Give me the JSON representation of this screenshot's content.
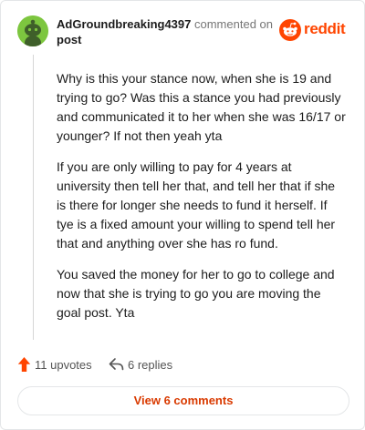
{
  "header": {
    "username": "AdGroundbreaking4397",
    "action_text": "commented on",
    "post_link": "post",
    "logo_text": "reddit",
    "avatar_icon": "reddit-snoo-avatar-icon",
    "logo_icon": "reddit-logo-icon"
  },
  "comment": {
    "paragraphs": [
      "Why is this your stance now, when she is 19 and trying to go? Was this a stance you had previously and communicated it to her when she was 16/17 or younger? If not then yeah yta",
      "If you are only willing to pay for 4 years at university then tell her that, and tell her that if she is there for longer she needs to fund it herself. If tye is a fixed amount your willing to spend tell her that and anything over she has ro fund.",
      "You saved the money for her to go to college and now that she is trying to go you are moving the goal post. Yta"
    ]
  },
  "actions": {
    "upvotes_label": "11 upvotes",
    "replies_label": "6 replies",
    "upvote_icon": "upvote-arrow-icon",
    "reply_icon": "reply-arrow-icon"
  },
  "footer": {
    "view_comments_label": "View 6 comments"
  },
  "colors": {
    "brand": "#ff4500",
    "link_accent": "#d93a00",
    "avatar_bg": "#7dc63f",
    "muted_text": "#767676",
    "border": "#e4e6e8"
  }
}
